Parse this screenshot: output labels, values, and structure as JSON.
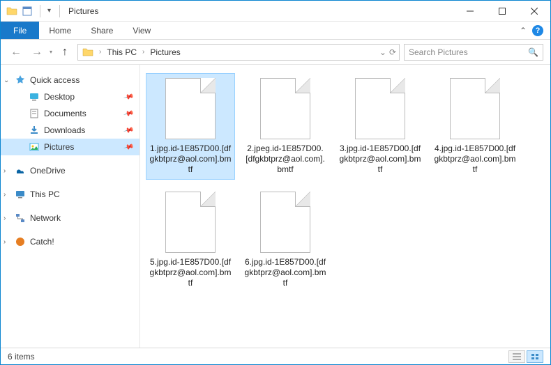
{
  "title": "Pictures",
  "ribbon": {
    "file": "File",
    "tabs": [
      "Home",
      "Share",
      "View"
    ]
  },
  "breadcrumb": {
    "items": [
      "This PC",
      "Pictures"
    ]
  },
  "search": {
    "placeholder": "Search Pictures"
  },
  "sidebar": {
    "quick_access": "Quick access",
    "items": [
      {
        "label": "Desktop",
        "pinned": true
      },
      {
        "label": "Documents",
        "pinned": true
      },
      {
        "label": "Downloads",
        "pinned": true
      },
      {
        "label": "Pictures",
        "pinned": true,
        "selected": true
      }
    ],
    "onedrive": "OneDrive",
    "thispc": "This PC",
    "network": "Network",
    "catch": "Catch!"
  },
  "files": [
    {
      "name": "1.jpg.id-1E857D00.[dfgkbtprz@aol.com].bmtf",
      "selected": true
    },
    {
      "name": "2.jpeg.id-1E857D00.[dfgkbtprz@aol.com].bmtf"
    },
    {
      "name": "3.jpg.id-1E857D00.[dfgkbtprz@aol.com].bmtf"
    },
    {
      "name": "4.jpg.id-1E857D00.[dfgkbtprz@aol.com].bmtf"
    },
    {
      "name": "5.jpg.id-1E857D00.[dfgkbtprz@aol.com].bmtf"
    },
    {
      "name": "6.jpg.id-1E857D00.[dfgkbtprz@aol.com].bmtf"
    }
  ],
  "status": {
    "count": "6 items"
  }
}
